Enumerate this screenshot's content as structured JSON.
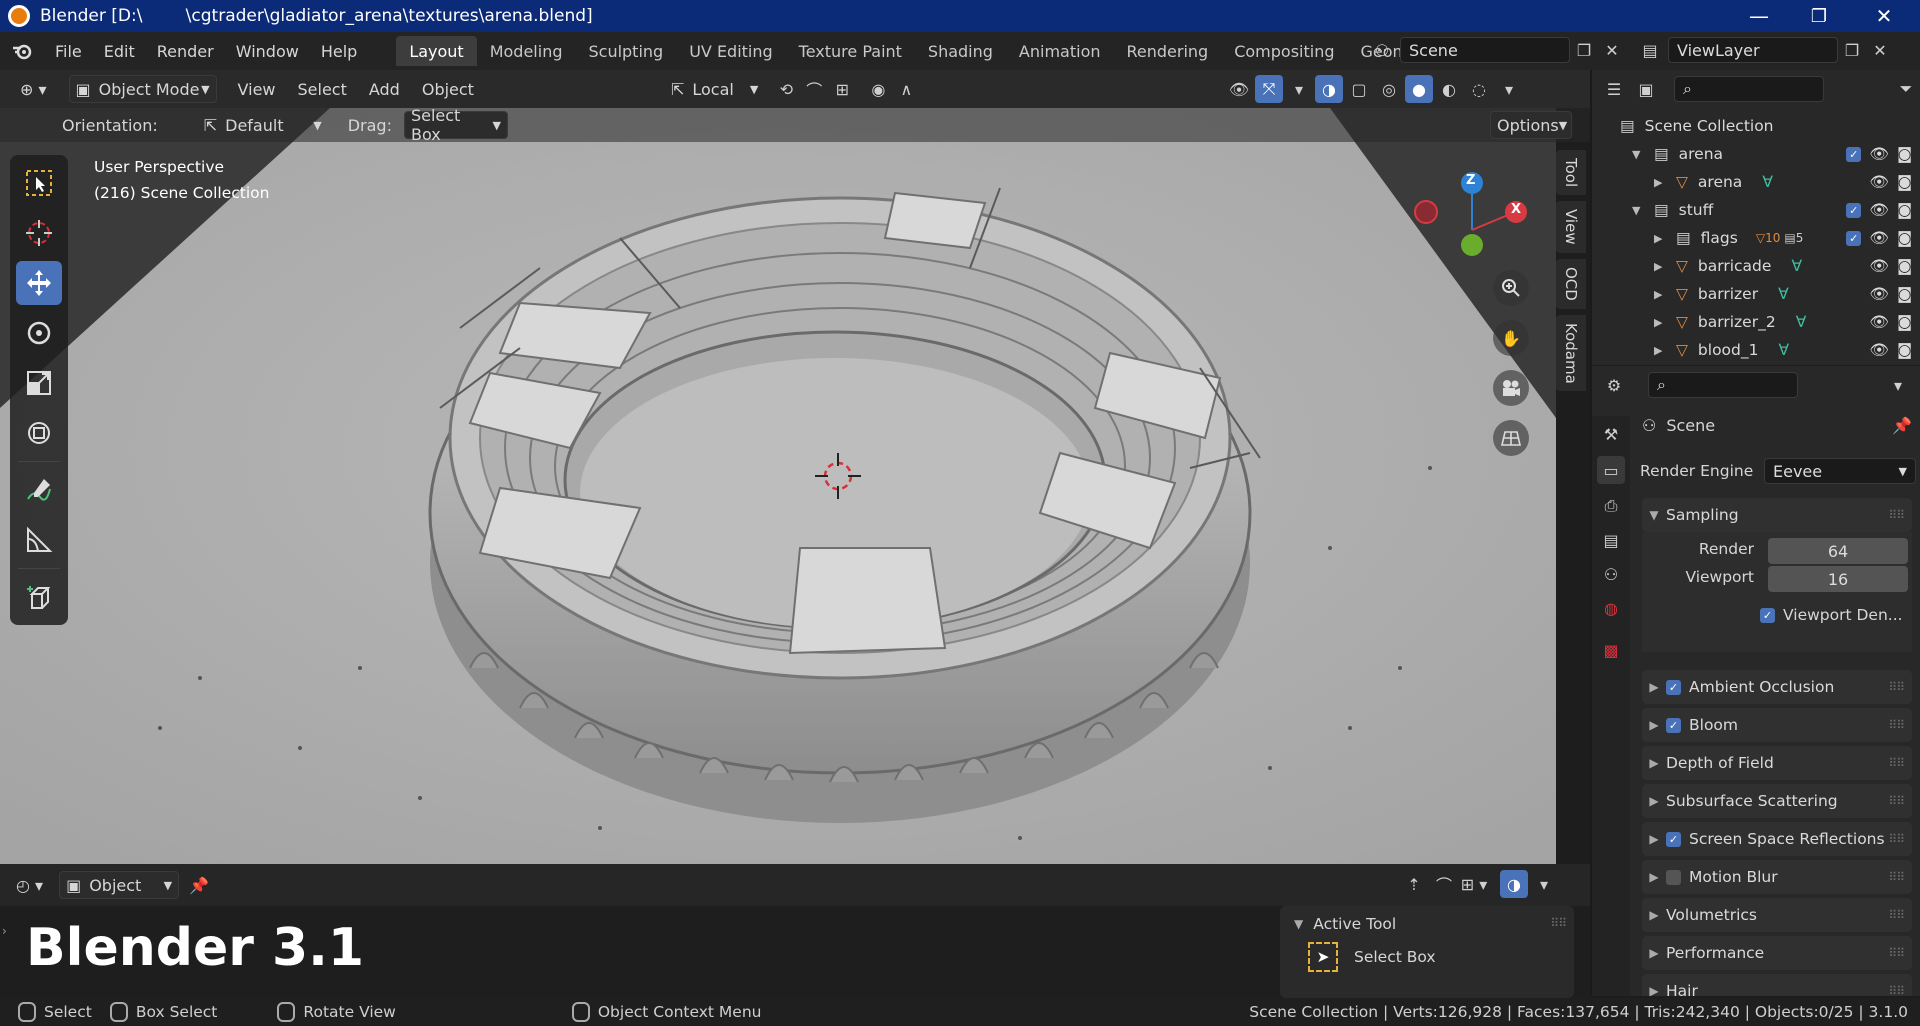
{
  "window": {
    "title": "Blender [D:\\        \\cgtrader\\gladiator_arena\\textures\\arena.blend]",
    "minimize": "—",
    "maximize": "❐",
    "close": "✕"
  },
  "menubar": {
    "items": [
      "File",
      "Edit",
      "Render",
      "Window",
      "Help"
    ],
    "workspaces": [
      "Layout",
      "Modeling",
      "Sculpting",
      "UV Editing",
      "Texture Paint",
      "Shading",
      "Animation",
      "Rendering",
      "Compositing",
      "Geometry Nod"
    ],
    "active_workspace": "Layout",
    "scene": "Scene",
    "view_layer": "ViewLayer"
  },
  "viewport_header": {
    "mode": "Object Mode",
    "menus": [
      "View",
      "Select",
      "Add",
      "Object"
    ],
    "transform_orientation": "Local"
  },
  "tool_settings": {
    "orientation_label": "Orientation:",
    "orientation_value": "Default",
    "drag_label": "Drag:",
    "drag_value": "Select Box",
    "options": "Options"
  },
  "viewport": {
    "perspective": "User Perspective",
    "collection_info": "(216) Scene Collection",
    "side_tabs": [
      "Tool",
      "View",
      "OCD",
      "Kodama"
    ],
    "gizmo": {
      "z": "Z",
      "x": "X"
    },
    "overlay_text": "Blender 3.1"
  },
  "outliner": {
    "root": "Scene Collection",
    "rows": [
      {
        "name": "arena",
        "level": 1,
        "type": "collection",
        "expanded": true
      },
      {
        "name": "arena",
        "level": 2,
        "type": "mesh"
      },
      {
        "name": "stuff",
        "level": 1,
        "type": "collection",
        "expanded": true
      },
      {
        "name": "flags",
        "level": 2,
        "type": "collection",
        "badge1": "10",
        "badge2": "5"
      },
      {
        "name": "barricade",
        "level": 2,
        "type": "mesh"
      },
      {
        "name": "barrizer",
        "level": 2,
        "type": "mesh"
      },
      {
        "name": "barrizer_2",
        "level": 2,
        "type": "mesh"
      },
      {
        "name": "blood_1",
        "level": 2,
        "type": "mesh"
      }
    ]
  },
  "properties": {
    "context": "Scene",
    "render_engine_label": "Render Engine",
    "render_engine": "Eevee",
    "sampling": {
      "label": "Sampling",
      "render_label": "Render",
      "render_value": "64",
      "viewport_label": "Viewport",
      "viewport_value": "16",
      "denoise_label": "Viewport Den..."
    },
    "panels": [
      {
        "label": "Ambient Occlusion",
        "checkbox": true
      },
      {
        "label": "Bloom",
        "checkbox": true
      },
      {
        "label": "Depth of Field",
        "checkbox": null
      },
      {
        "label": "Subsurface Scattering",
        "checkbox": null
      },
      {
        "label": "Screen Space Reflections",
        "checkbox": true
      },
      {
        "label": "Motion Blur",
        "checkbox": false
      },
      {
        "label": "Volumetrics",
        "checkbox": null
      },
      {
        "label": "Performance",
        "checkbox": null
      },
      {
        "label": "Hair",
        "checkbox": null
      }
    ]
  },
  "bottom": {
    "object_menu": "Object",
    "active_tool_label": "Active Tool",
    "active_tool_value": "Select Box"
  },
  "statusbar": {
    "select": "Select",
    "box_select": "Box Select",
    "rotate_view": "Rotate View",
    "context_menu": "Object Context Menu",
    "stats": "Scene Collection | Verts:126,928 | Faces:137,654 | Tris:242,340 | Objects:0/25 | 3.1.0"
  },
  "colors": {
    "accent": "#4a72b8",
    "titlebar": "#0b2b78",
    "gizmo_z": "#2e82d6",
    "gizmo_x": "#d83a44",
    "gizmo_y": "#6aad2d",
    "mesh_icon": "#e48a3c"
  }
}
